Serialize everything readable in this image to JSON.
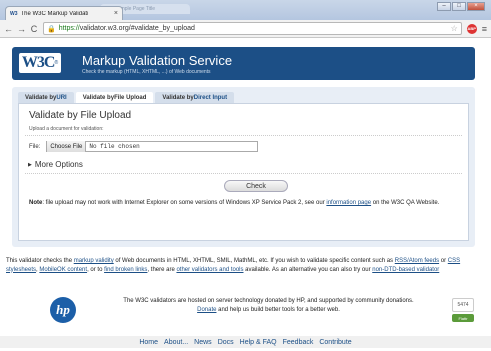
{
  "browser": {
    "tab_favicon": "W3",
    "tab_title": "The W3C Markup Validati",
    "tab_close": "×",
    "second_tab_title": "Example Page Title",
    "url_https": "https://",
    "url_rest": "validator.w3.org/#validate_by_upload",
    "back_glyph": "←",
    "forward_glyph": "→",
    "reload_glyph": "C",
    "home_glyph": "⌂",
    "star_glyph": "☆",
    "menu_glyph": "≡",
    "ext_label": "ABP",
    "minimize": "–",
    "maximize": "□",
    "close": "×"
  },
  "banner": {
    "logo": "W3C",
    "logo_reg": "®",
    "title": "Markup Validation Service",
    "subtitle": "Check the markup (HTML, XHTML, ...) of Web documents"
  },
  "tabs": [
    {
      "prefix": "Validate by ",
      "link": "URI"
    },
    {
      "prefix": "Validate by ",
      "link": "File Upload"
    },
    {
      "prefix": "Validate by ",
      "link": "Direct Input"
    }
  ],
  "upload": {
    "heading": "Validate by File Upload",
    "description": "Upload a document for validation:",
    "file_label": "File:",
    "choose_button": "Choose File",
    "file_status": "No file chosen",
    "more_options": "More Options",
    "check_button": "Check",
    "note_bold": "Note",
    "note_text": ": file upload may not work with Internet Explorer on some versions of Windows XP Service Pack 2, see our ",
    "note_link": "information page",
    "note_end": " on the W3C QA Website."
  },
  "about": {
    "t1": "This validator checks the ",
    "l1": "markup validity",
    "t2": " of Web documents in HTML, XHTML, SMIL, MathML, etc. If you wish to validate specific content such as ",
    "l2": "RSS/Atom feeds",
    "t3": " or ",
    "l3": "CSS stylesheets",
    "t4": ", ",
    "l4": "MobileOK content",
    "t5": ", or to ",
    "l5": "find broken links",
    "t6": ", there are ",
    "l6": "other validators and tools",
    "t7": " available. As an alternative you can also try our ",
    "l7": "non-DTD-based validator"
  },
  "sponsor": {
    "logo": "hp",
    "t1": "The W3C validators are hosted on server technology donated by HP, and supported by community donations.",
    "link": "Donate",
    "t2": " and help us build better tools for a better web.",
    "flattr_count": "5474",
    "flattr_label": "Flattr"
  },
  "footer_nav": [
    "Home",
    "About...",
    "News",
    "Docs",
    "Help & FAQ",
    "Feedback",
    "Contribute"
  ]
}
